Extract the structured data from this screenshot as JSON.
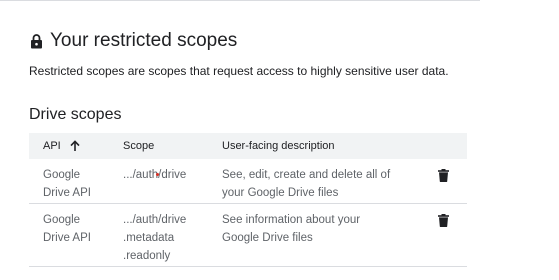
{
  "section": {
    "title": "Your restricted scopes",
    "description": "Restricted scopes are scopes that request access to highly sensitive user data."
  },
  "drive": {
    "title": "Drive scopes",
    "columns": {
      "api": "API",
      "scope": "Scope",
      "description": "User-facing description"
    },
    "rows": [
      {
        "api_line1": "Google",
        "api_line2": "Drive API",
        "scope_line1": ".../auth/drive",
        "scope_line2": "",
        "scope_line3": "",
        "desc_line1": "See, edit, create and delete all of",
        "desc_line2": "your Google Drive files"
      },
      {
        "api_line1": "Google",
        "api_line2": "Drive API",
        "scope_line1": ".../auth/drive",
        "scope_line2": ".metadata",
        "scope_line3": ".readonly",
        "desc_line1": "See information about your",
        "desc_line2": "Google Drive files"
      }
    ]
  },
  "icons": {
    "lock": "lock-icon",
    "sort": "arrow-up-icon",
    "delete": "trash-icon"
  },
  "colors": {
    "text_primary": "#202124",
    "text_secondary": "#5f6368",
    "header_bg": "#f1f3f4",
    "divider": "#dadce0"
  }
}
